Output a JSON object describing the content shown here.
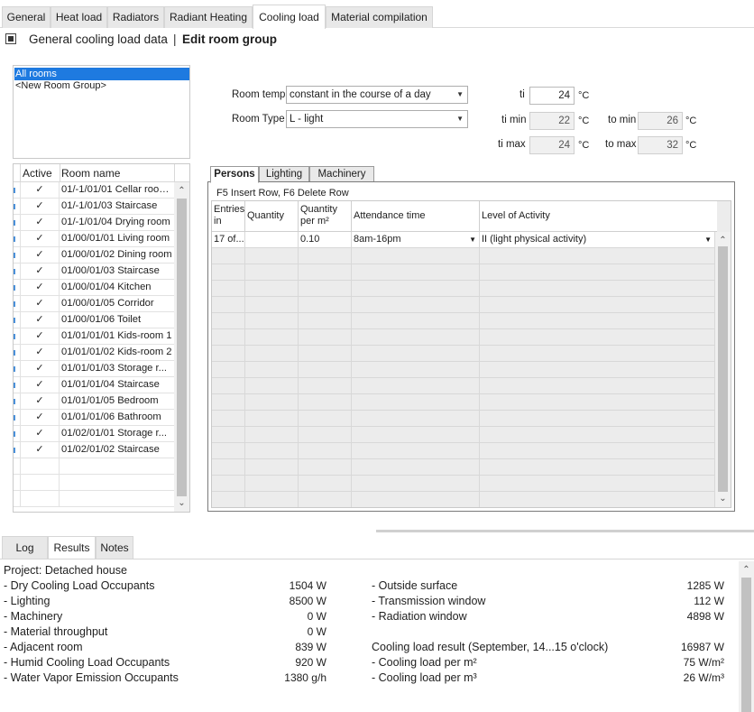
{
  "top_tabs": [
    "General",
    "Heat load",
    "Radiators",
    "Radiant Heating",
    "Cooling load",
    "Material compilation"
  ],
  "header": {
    "general": "General cooling load data",
    "separator": "|",
    "edit": "Edit room group"
  },
  "room_groups": [
    "All rooms",
    "<New Room Group>"
  ],
  "room_table": {
    "col_active": "Active",
    "col_name": "Room name",
    "check": "✓",
    "rows": [
      "01/-1/01/01 Cellar room...",
      "01/-1/01/03 Staircase",
      "01/-1/01/04 Drying room",
      "01/00/01/01 Living room",
      "01/00/01/02 Dining room",
      "01/00/01/03 Staircase",
      "01/00/01/04 Kitchen",
      "01/00/01/05 Corridor",
      "01/00/01/06 Toilet",
      "01/01/01/01 Kids-room 1",
      "01/01/01/02 Kids-room 2",
      "01/01/01/03 Storage r...",
      "01/01/01/04 Staircase",
      "01/01/01/05 Bedroom",
      "01/01/01/06 Bathroom",
      "01/02/01/01 Storage r...",
      "01/02/01/02 Staircase"
    ]
  },
  "form": {
    "room_temp_label": "Room temp.",
    "room_temp_value": "constant in the course of a day",
    "room_type_label": "Room Type",
    "room_type_value": "L - light",
    "ti_label": "ti",
    "ti_value": "24",
    "timin_label": "ti min",
    "timin_value": "22",
    "timax_label": "ti max",
    "timax_value": "24",
    "tomin_label": "to min",
    "tomin_value": "26",
    "tomax_label": "to max",
    "tomax_value": "32",
    "unit": "°C"
  },
  "persons_tabs": [
    "Persons",
    "Lighting",
    "Machinery"
  ],
  "persons": {
    "hint": "F5 Insert Row, F6 Delete Row",
    "headers": [
      "Entries in",
      "Quantity",
      "Quantity per m²",
      "Attendance time",
      "Level of Activity"
    ],
    "row": {
      "entries": "17 of...",
      "quantity": "",
      "per_m2": "0.10",
      "attendance": "8am-16pm",
      "activity": "II (light physical activity)"
    }
  },
  "bottom_tabs": [
    "Log",
    "Results",
    "Notes"
  ],
  "results": {
    "project": "Project: Detached house",
    "left": [
      {
        "label": "- Dry Cooling Load Occupants",
        "value": "1504 W"
      },
      {
        "label": "- Lighting",
        "value": "8500 W"
      },
      {
        "label": "- Machinery",
        "value": "0 W"
      },
      {
        "label": "- Material throughput",
        "value": "0 W"
      },
      {
        "label": "- Adjacent room",
        "value": "839 W"
      },
      {
        "label": "- Humid Cooling Load Occupants",
        "value": "920 W"
      },
      {
        "label": "- Water Vapor Emission Occupants",
        "value": "1380 g/h"
      }
    ],
    "right": [
      {
        "label": "- Outside surface",
        "value": "1285 W"
      },
      {
        "label": "- Transmission window",
        "value": "112 W"
      },
      {
        "label": "- Radiation window",
        "value": "4898 W"
      },
      {
        "label": "",
        "value": ""
      },
      {
        "label": "Cooling load result (September, 14...15 o'clock)",
        "value": "16987 W"
      },
      {
        "label": "- Cooling load per m²",
        "value": "75 W/m²"
      },
      {
        "label": "- Cooling load per m³",
        "value": "26 W/m³"
      }
    ]
  },
  "colors": {
    "selection": "#1e7ae0",
    "tab_bg": "#e8e8e8"
  },
  "icons": {
    "checkbox": "checkbox-icon",
    "dropdown": "chevron-down-icon",
    "scroll_up": "chevron-up-icon",
    "scroll_down": "chevron-down-icon"
  }
}
